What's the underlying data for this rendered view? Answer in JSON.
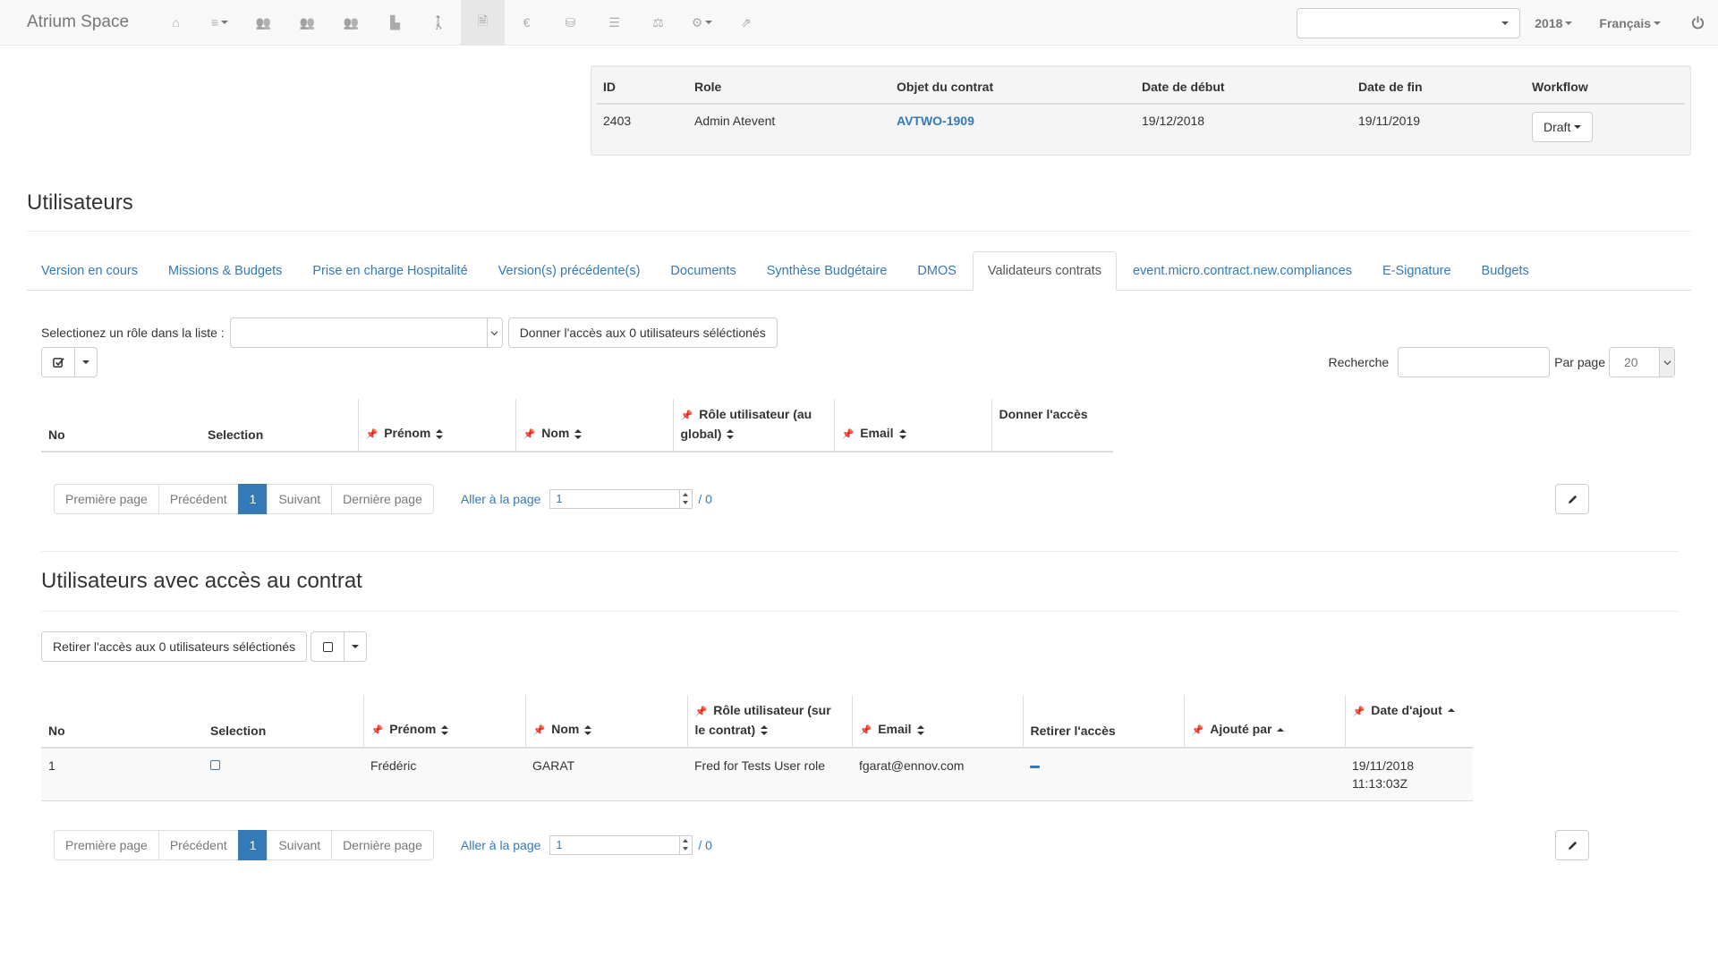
{
  "navbar": {
    "brand": "Atrium Space",
    "icons": [
      {
        "name": "home-icon",
        "glyph": "⌂",
        "dropdown": false,
        "active": false
      },
      {
        "name": "list-menu-icon",
        "glyph": "≡",
        "dropdown": true,
        "active": false
      },
      {
        "name": "users-icon",
        "glyph": "👥",
        "dropdown": false,
        "active": false
      },
      {
        "name": "users-group-icon",
        "glyph": "👥",
        "dropdown": false,
        "active": false
      },
      {
        "name": "users-team-icon",
        "glyph": "👥",
        "dropdown": false,
        "active": false
      },
      {
        "name": "bar-chart-icon",
        "glyph": "▙",
        "dropdown": false,
        "active": false
      },
      {
        "name": "person-icon",
        "glyph": "🚶",
        "dropdown": false,
        "active": false
      },
      {
        "name": "document-icon",
        "glyph": "🗎",
        "dropdown": false,
        "active": true
      },
      {
        "name": "euro-icon",
        "glyph": "€",
        "dropdown": false,
        "active": false
      },
      {
        "name": "database-icon",
        "glyph": "⛁",
        "dropdown": false,
        "active": false
      },
      {
        "name": "list-icon",
        "glyph": "☰",
        "dropdown": false,
        "active": false
      },
      {
        "name": "scale-icon",
        "glyph": "⚖",
        "dropdown": false,
        "active": false
      },
      {
        "name": "settings-icon",
        "glyph": "⚙",
        "dropdown": true,
        "active": false
      },
      {
        "name": "share-icon",
        "glyph": "⇗",
        "dropdown": false,
        "active": false
      }
    ],
    "search_value": "",
    "year": "2018",
    "language": "Français"
  },
  "contract": {
    "headers": {
      "id": "ID",
      "role": "Role",
      "object": "Objet du contrat",
      "start": "Date de début",
      "end": "Date de fin",
      "workflow": "Workflow"
    },
    "row": {
      "id": "2403",
      "role": "Admin Atevent",
      "object": "AVTWO-1909",
      "start": "19/12/2018",
      "end": "19/11/2019",
      "workflow": "Draft"
    }
  },
  "page_title": "Utilisateurs",
  "tabs": [
    {
      "label": "Version en cours",
      "active": false
    },
    {
      "label": "Missions & Budgets",
      "active": false
    },
    {
      "label": "Prise en charge Hospitalité",
      "active": false
    },
    {
      "label": "Version(s) précédente(s)",
      "active": false
    },
    {
      "label": "Documents",
      "active": false
    },
    {
      "label": "Synthèse Budgétaire",
      "active": false
    },
    {
      "label": "DMOS",
      "active": false
    },
    {
      "label": "Validateurs contrats",
      "active": true
    },
    {
      "label": "event.micro.contract.new.compliances",
      "active": false
    },
    {
      "label": "E-Signature",
      "active": false
    },
    {
      "label": "Budgets",
      "active": false
    }
  ],
  "validators": {
    "role_label": "Selectionez un rôle dans la liste :",
    "role_value": "",
    "grant_button": "Donner l'accès aux 0 utilisateurs séléctionés",
    "search_label": "Recherche",
    "search_value": "",
    "per_page_label": "Par page",
    "per_page_value": "20",
    "columns": {
      "no": "No",
      "selection": "Selection",
      "firstname": "Prénom",
      "lastname": "Nom",
      "role": "Rôle utilisateur (au global)",
      "email": "Email",
      "grant": "Donner l'accès"
    }
  },
  "pagination": {
    "first": "Première page",
    "prev": "Précédent",
    "current": "1",
    "next": "Suivant",
    "last": "Dernière page",
    "goto_label": "Aller à la page",
    "goto_value": "1",
    "total": "/ 0"
  },
  "access": {
    "title": "Utilisateurs avec accès au contrat",
    "revoke_button": "Retirer l'accès aux 0 utilisateurs séléctionés",
    "columns": {
      "no": "No",
      "selection": "Selection",
      "firstname": "Prénom",
      "lastname": "Nom",
      "role": "Rôle utilisateur (sur le contrat)",
      "email": "Email",
      "revoke": "Retirer l'accès",
      "added_by": "Ajouté par",
      "added_on": "Date d'ajout"
    },
    "rows": [
      {
        "no": "1",
        "firstname": "Frédéric",
        "lastname": "GARAT",
        "role": "Fred for Tests User role",
        "email": "fgarat@ennov.com",
        "added_by": "",
        "date": "19/11/2018",
        "time": "11:13:03Z"
      }
    ]
  },
  "pagination2": {
    "first": "Première page",
    "prev": "Précédent",
    "current": "1",
    "next": "Suivant",
    "last": "Dernière page",
    "goto_label": "Aller à la page",
    "goto_value": "1",
    "total": "/ 0"
  }
}
